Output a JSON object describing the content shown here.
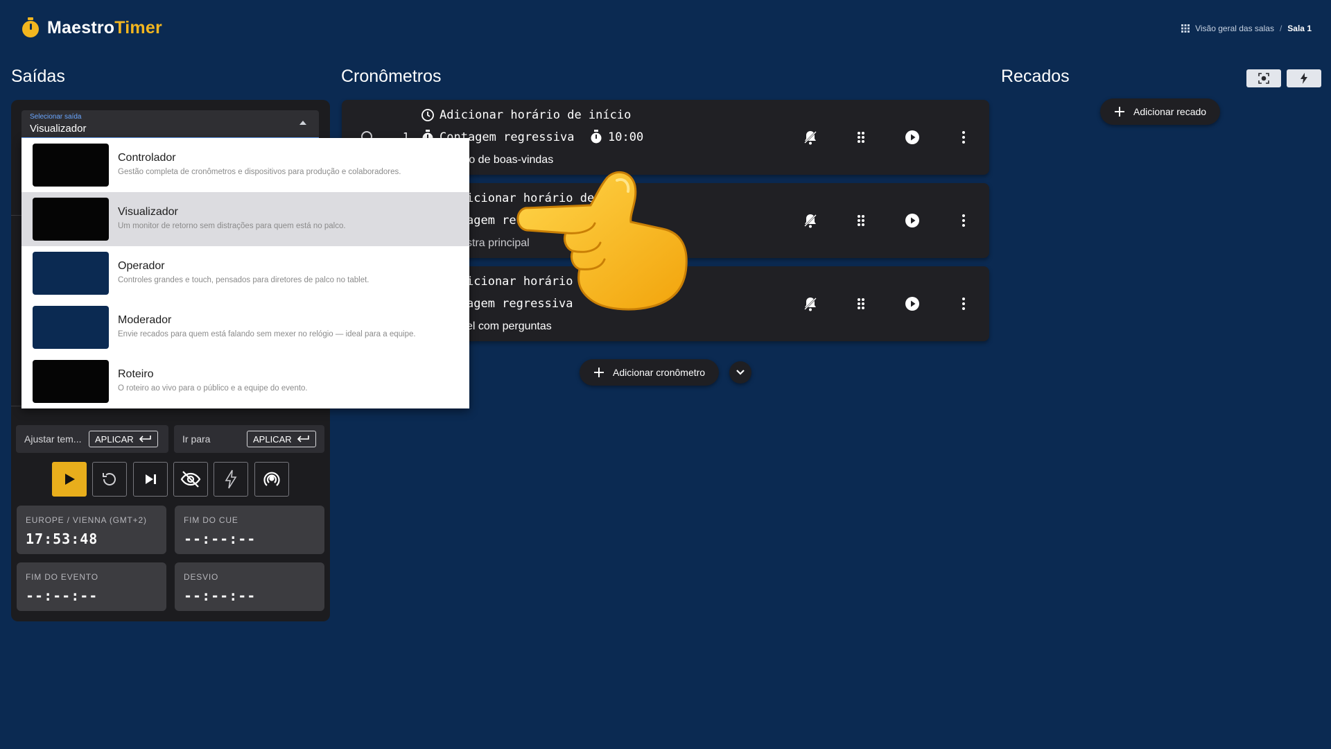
{
  "app": {
    "name_part1": "Maestro",
    "name_part2": "Timer"
  },
  "breadcrumb": {
    "overview": "Visão geral das salas",
    "separator": "/",
    "current": "Sala 1"
  },
  "outputs": {
    "title": "Saídas",
    "select": {
      "caption": "Selecionar saída",
      "value": "Visualizador"
    },
    "options": [
      {
        "title": "Controlador",
        "description": "Gestão completa de cronômetros e dispositivos para produção e colaboradores.",
        "thumb_color": "#050505"
      },
      {
        "title": "Visualizador",
        "description": "Um monitor de retorno sem distrações para quem está no palco.",
        "thumb_color": "#050505",
        "selected": true
      },
      {
        "title": "Operador",
        "description": "Controles grandes e touch, pensados para diretores de palco no tablet.",
        "thumb_color": "#0b2a52"
      },
      {
        "title": "Moderador",
        "description": "Envie recados para quem está falando sem mexer no relógio — ideal para a equipe.",
        "thumb_color": "#0b2a52"
      },
      {
        "title": "Roteiro",
        "description": "O roteiro ao vivo para o público e a equipe do evento.",
        "thumb_color": "#050505"
      }
    ]
  },
  "controls": {
    "adjust_label": "Ajustar tem...",
    "goto_label": "Ir para",
    "apply_label": "APLICAR",
    "transport_icons": [
      "play-icon",
      "reset-icon",
      "skip-next-icon",
      "eye-off-icon",
      "flash-icon",
      "broadcast-icon"
    ],
    "clock": {
      "label": "EUROPE / VIENNA (GMT+2)",
      "value": "17:53:48"
    },
    "cue_end": {
      "label": "FIM DO CUE",
      "value": "--:--:--"
    },
    "event_end": {
      "label": "FIM DO EVENTO",
      "value": "--:--:--"
    },
    "deviation": {
      "label": "DESVIO",
      "value": "--:--:--"
    }
  },
  "timers": {
    "title": "Cronômetros",
    "items": [
      {
        "line1": "Adicionar horário de início",
        "index": "1",
        "line2": "Contagem regressiva",
        "duration": "10:00",
        "line3": "rso de boas-vindas"
      },
      {
        "line1": "icionar horário de ini",
        "line2": "agem re",
        "line3": "stra principal"
      },
      {
        "line1": "icionar horário de",
        "line2": "agem regressiva",
        "line3": "el com perguntas"
      }
    ],
    "add_label": "Adicionar cronômetro"
  },
  "messages": {
    "title": "Recados",
    "add_label": "Adicionar recado"
  },
  "colors": {
    "background": "#0b2a52",
    "accent": "#f3b61f",
    "panel": "#1c1c1f",
    "card": "#202024"
  }
}
